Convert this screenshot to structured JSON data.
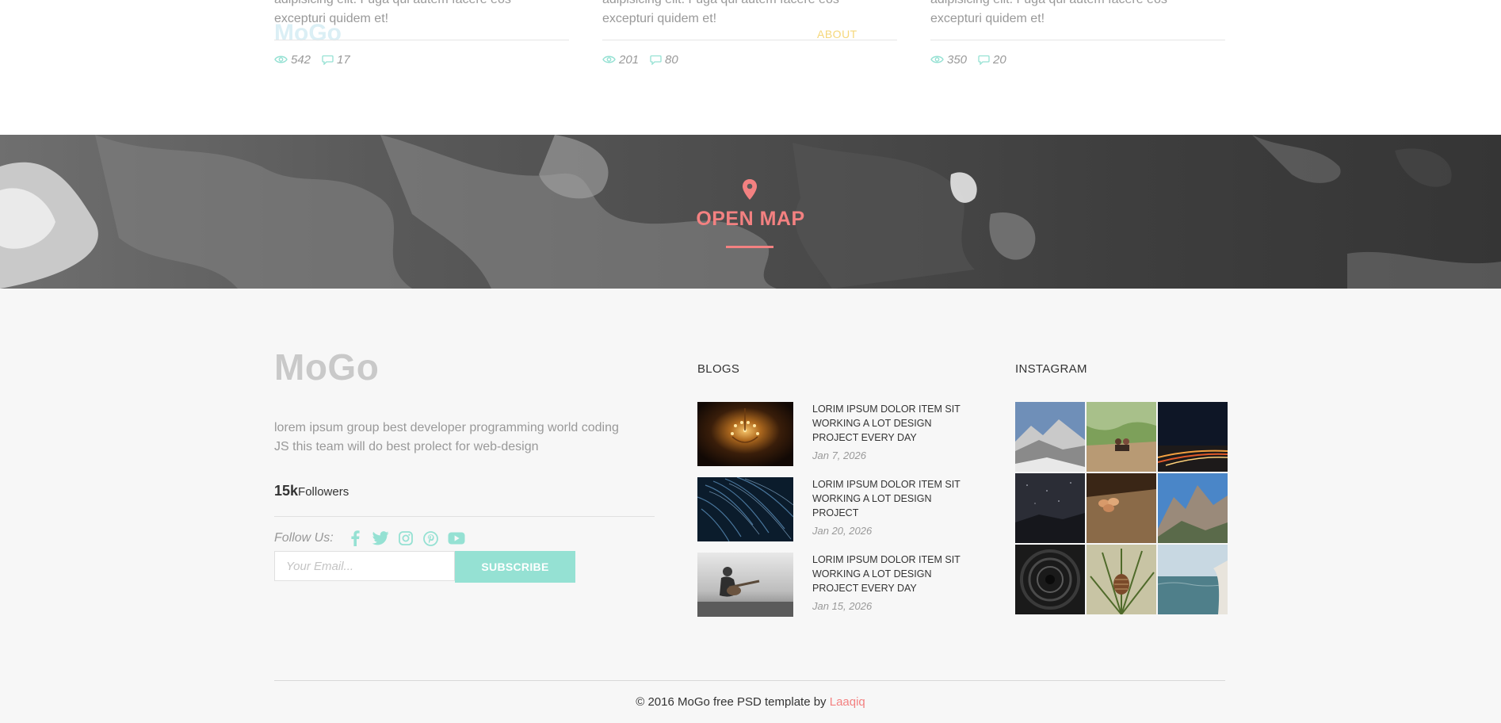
{
  "posts": [
    {
      "text_line1": "adipisicing elit. Fuga qui autem facere eos",
      "text_line2": "excepturi quidem et!",
      "views": "542",
      "comments": "17"
    },
    {
      "text_line1": "adipisicing elit. Fuga qui autem facere eos",
      "text_line2": "excepturi quidem et!",
      "views": "201",
      "comments": "80"
    },
    {
      "text_line1": "adipisicing elit. Fuga qui autem facere eos",
      "text_line2": "excepturi quidem et!",
      "views": "350",
      "comments": "20"
    }
  ],
  "overlay": {
    "logo": "MoGo",
    "nav_about": "ABOUT"
  },
  "map": {
    "icon": "map-pin-icon",
    "label": "OPEN MAP"
  },
  "footer": {
    "logo": "MoGo",
    "description_line1": "lorem ipsum group best developer programming world coding",
    "description_line2": "JS this team will do best prolect for web-design",
    "followers_count": "15k",
    "followers_label": "Followers",
    "follow_us_label": "Follow Us:",
    "social_icons": [
      "facebook-icon",
      "twitter-icon",
      "instagram-icon",
      "pinterest-icon",
      "youtube-icon"
    ],
    "email_placeholder": "Your Email...",
    "subscribe_label": "SUBSCRIBE",
    "blogs_title": "BLOGS",
    "blogs": [
      {
        "line1": "LORIM IPSUM DOLOR ITEM SIT",
        "line2": "WORKING A LOT DESIGN",
        "line3": "PROJECT EVERY DAY",
        "date": "Jan 7, 2026"
      },
      {
        "line1": "LORIM IPSUM DOLOR ITEM SIT",
        "line2": "WORKING A LOT DESIGN",
        "line3": "PROJECT",
        "date": "Jan 20, 2026"
      },
      {
        "line1": "LORIM IPSUM DOLOR ITEM SIT",
        "line2": "WORKING A LOT DESIGN",
        "line3": "PROJECT EVERY DAY",
        "date": "Jan 15, 2026"
      }
    ],
    "instagram_title": "INSTAGRAM",
    "copyright_text": "© 2016 MoGo free PSD template by ",
    "copyright_link": "Laaqiq"
  },
  "colors": {
    "accent": "#f38181",
    "teal": "#95e1d3",
    "footer_bg": "#f7f7f7",
    "muted_text": "#999999"
  }
}
